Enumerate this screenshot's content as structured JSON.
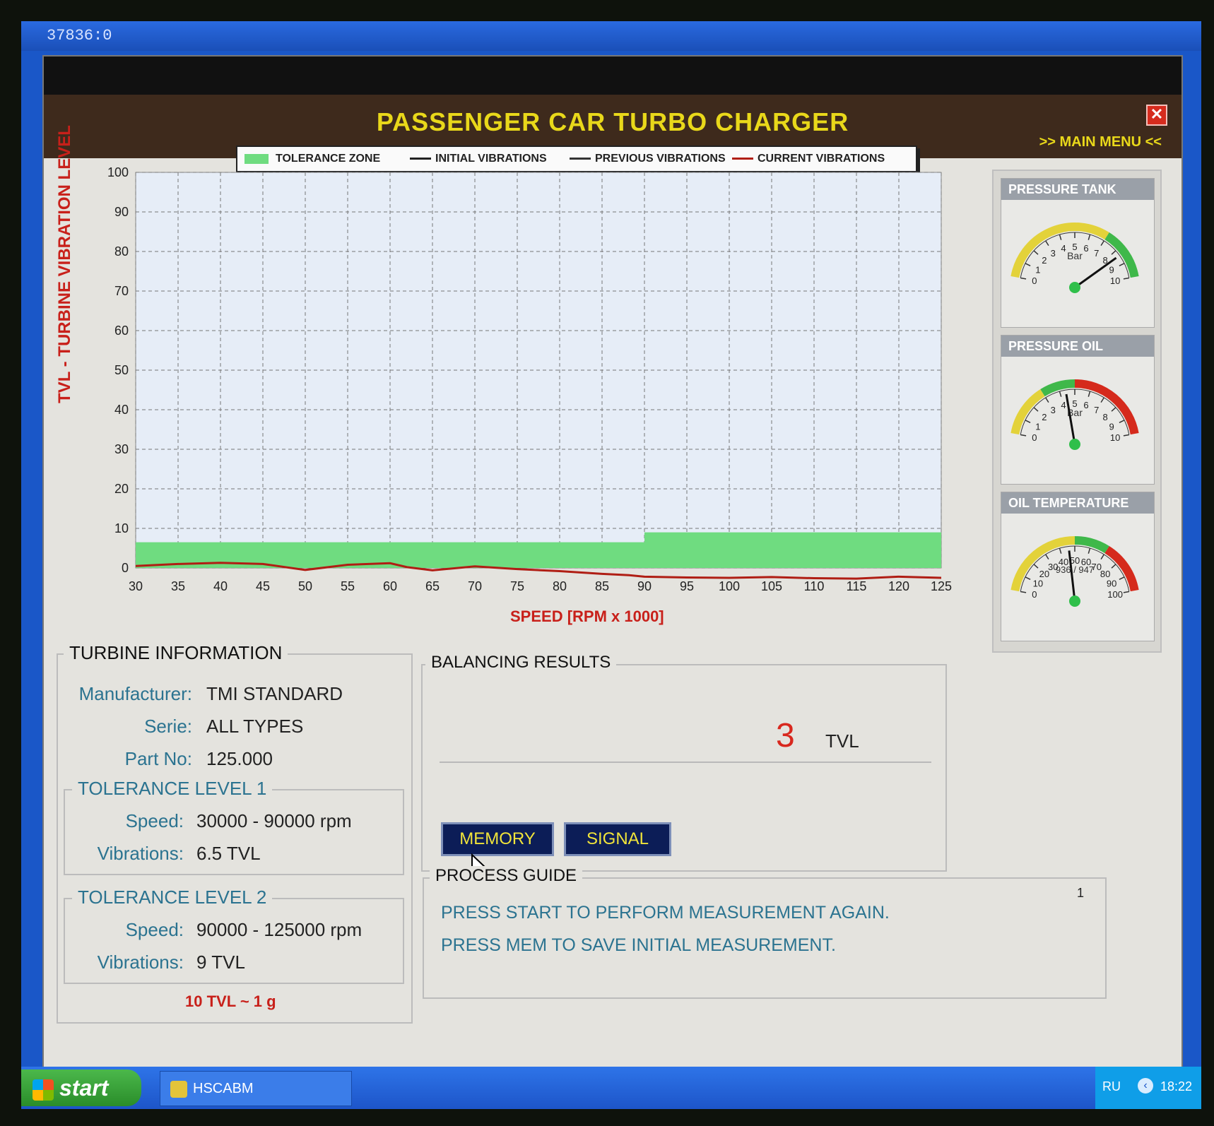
{
  "window": {
    "caption": "37836:0"
  },
  "app": {
    "title": "PASSENGER CAR TURBO CHARGER",
    "close_glyph": "✕",
    "main_menu": ">> MAIN  MENU <<"
  },
  "legend": {
    "tolerance_zone": "TOLERANCE ZONE",
    "initial": "INITIAL VIBRATIONS",
    "previous": "PREVIOUS VIBRATIONS",
    "current": "CURRENT VIBRATIONS"
  },
  "chart_data": {
    "type": "line",
    "ylabel": "TVL - TURBINE VIBRATION LEVEL",
    "xlabel": "SPEED [RPM x 1000]",
    "xlim": [
      30,
      125
    ],
    "ylim": [
      0,
      100
    ],
    "xticks": [
      30,
      35,
      40,
      45,
      50,
      55,
      60,
      65,
      70,
      75,
      80,
      85,
      90,
      95,
      100,
      105,
      110,
      115,
      120,
      125
    ],
    "yticks": [
      0,
      10,
      20,
      30,
      40,
      50,
      60,
      70,
      80,
      90,
      100
    ],
    "grid": true,
    "legend_position": "top",
    "tolerance_zone": [
      {
        "x_range": [
          30,
          90
        ],
        "max": 6.5
      },
      {
        "x_range": [
          90,
          125
        ],
        "max": 9
      }
    ],
    "series": [
      {
        "name": "CURRENT VIBRATIONS",
        "color": "#b01e14",
        "x": [
          30,
          35,
          40,
          45,
          50,
          55,
          60,
          62,
          65,
          70,
          75,
          80,
          85,
          88,
          90,
          95,
          100,
          105,
          110,
          115,
          120,
          125
        ],
        "y": [
          0.5,
          1.0,
          1.3,
          1.0,
          -0.5,
          0.8,
          1.2,
          0.2,
          -0.6,
          0.4,
          -0.3,
          -0.8,
          -1.5,
          -1.8,
          -2.2,
          -2.4,
          -2.5,
          -2.3,
          -2.6,
          -2.7,
          -2.2,
          -2.5
        ]
      }
    ],
    "zone_color": "#6fdc80"
  },
  "gauges": [
    {
      "title": "PRESSURE TANK",
      "unit": "Bar",
      "ticks": [
        "0",
        "1",
        "2",
        "3",
        "4",
        "5",
        "6",
        "7",
        "8",
        "9",
        "10"
      ],
      "value": 8.4,
      "min": 0,
      "max": 10,
      "readout": ""
    },
    {
      "title": "PRESSURE OIL",
      "unit": "Bar",
      "ticks": [
        "0",
        "1",
        "2",
        "3",
        "4",
        "5",
        "6",
        "7",
        "8",
        "9",
        "10"
      ],
      "value": 4.4,
      "min": 0,
      "max": 10,
      "readout": ""
    },
    {
      "title": "OIL TEMPERATURE",
      "unit": "",
      "ticks": [
        "0",
        "10",
        "20",
        "30",
        "40",
        "50",
        "60",
        "70",
        "80",
        "90",
        "100"
      ],
      "value": 46,
      "min": 0,
      "max": 100,
      "readout": "936 / 947"
    }
  ],
  "turbine_info": {
    "title": "TURBINE INFORMATION",
    "manufacturer_label": "Manufacturer:",
    "manufacturer": "TMI STANDARD",
    "serie_label": "Serie:",
    "serie": "ALL TYPES",
    "part_label": "Part No:",
    "part": "125.000",
    "tol1": {
      "title": "TOLERANCE LEVEL 1",
      "speed_label": "Speed:",
      "speed": "30000 - 90000 rpm",
      "vib_label": "Vibrations:",
      "vib": "6.5 TVL"
    },
    "tol2": {
      "title": "TOLERANCE LEVEL 2",
      "speed_label": "Speed:",
      "speed": "90000 - 125000 rpm",
      "vib_label": "Vibrations:",
      "vib": "9 TVL"
    },
    "note": "10 TVL ~ 1 g"
  },
  "balancing": {
    "title": "BALANCING RESULTS",
    "value": "3",
    "unit": "TVL",
    "memory": "MEMORY",
    "signal": "SIGNAL"
  },
  "process_guide": {
    "title": "PROCESS GUIDE",
    "number": "1",
    "line1": "PRESS START TO PERFORM MEASUREMENT AGAIN.",
    "line2": "PRESS MEM TO SAVE INITIAL MEASUREMENT."
  },
  "taskbar": {
    "start": "start",
    "task": "HSCABM",
    "lang": "RU",
    "clock": "18:22"
  }
}
